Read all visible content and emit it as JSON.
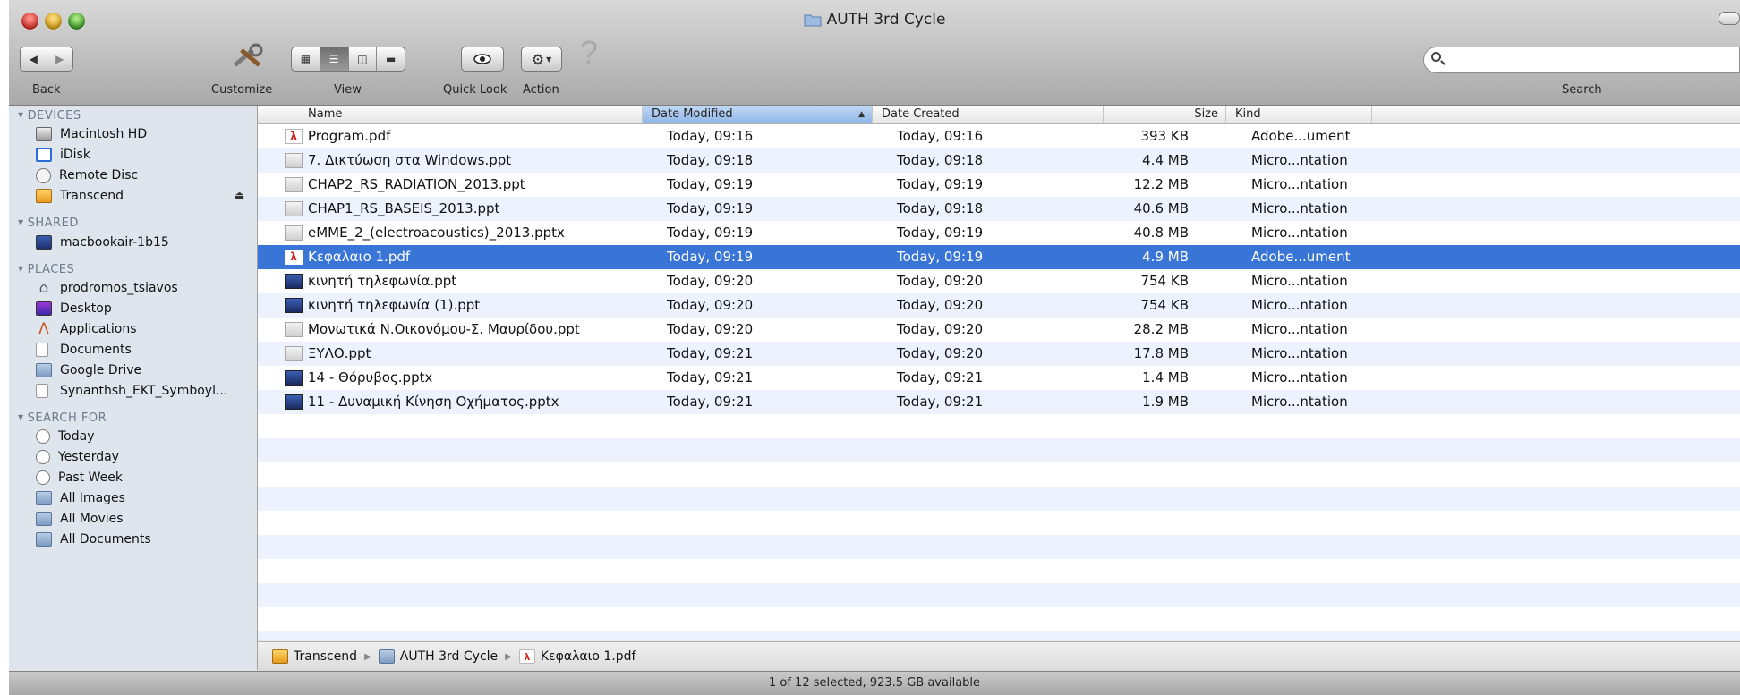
{
  "window": {
    "title": "AUTH 3rd Cycle"
  },
  "toolbar": {
    "back_label": "Back",
    "customize_label": "Customize",
    "view_label": "View",
    "quicklook_label": "Quick Look",
    "action_label": "Action",
    "search_label": "Search",
    "search_value": "",
    "view_modes": [
      "icon",
      "list",
      "column",
      "coverflow"
    ],
    "active_view_mode": "list"
  },
  "sidebar": {
    "sections": [
      {
        "heading": "DEVICES",
        "items": [
          {
            "label": "Macintosh HD",
            "icon": "hard-disk-icon"
          },
          {
            "label": "iDisk",
            "icon": "idisk-icon"
          },
          {
            "label": "Remote Disc",
            "icon": "remote-disc-icon"
          },
          {
            "label": "Transcend",
            "icon": "external-drive-icon",
            "ejectable": true
          }
        ]
      },
      {
        "heading": "SHARED",
        "items": [
          {
            "label": "macbookair-1b15",
            "icon": "computer-icon"
          }
        ]
      },
      {
        "heading": "PLACES",
        "items": [
          {
            "label": "prodromos_tsiavos",
            "icon": "home-icon"
          },
          {
            "label": "Desktop",
            "icon": "desktop-icon"
          },
          {
            "label": "Applications",
            "icon": "applications-icon"
          },
          {
            "label": "Documents",
            "icon": "documents-icon"
          },
          {
            "label": "Google Drive",
            "icon": "folder-icon"
          },
          {
            "label": "Synanthsh_EKT_Symboyl...",
            "icon": "document-icon"
          }
        ]
      },
      {
        "heading": "SEARCH FOR",
        "items": [
          {
            "label": "Today",
            "icon": "clock-icon"
          },
          {
            "label": "Yesterday",
            "icon": "clock-icon"
          },
          {
            "label": "Past Week",
            "icon": "clock-icon"
          },
          {
            "label": "All Images",
            "icon": "smart-folder-icon"
          },
          {
            "label": "All Movies",
            "icon": "smart-folder-icon"
          },
          {
            "label": "All Documents",
            "icon": "smart-folder-icon"
          }
        ]
      }
    ]
  },
  "columns": {
    "name": "Name",
    "date_modified": "Date Modified",
    "date_created": "Date Created",
    "size": "Size",
    "kind": "Kind",
    "sorted_by": "date_modified",
    "sort_direction": "ascending"
  },
  "files": [
    {
      "name": "Program.pdf",
      "modified": "Today, 09:16",
      "created": "Today, 09:16",
      "size": "393 KB",
      "kind": "Adobe...ument",
      "icon": "pdf-icon"
    },
    {
      "name": "7. Δικτύωση στα Windows.ppt",
      "modified": "Today, 09:18",
      "created": "Today, 09:18",
      "size": "4.4 MB",
      "kind": "Micro...ntation",
      "icon": "ppt-icon"
    },
    {
      "name": "CHAP2_RS_RADIATION_2013.ppt",
      "modified": "Today, 09:19",
      "created": "Today, 09:19",
      "size": "12.2 MB",
      "kind": "Micro...ntation",
      "icon": "ppt-icon"
    },
    {
      "name": "CHAP1_RS_BASEIS_2013.ppt",
      "modified": "Today, 09:19",
      "created": "Today, 09:18",
      "size": "40.6 MB",
      "kind": "Micro...ntation",
      "icon": "ppt-icon"
    },
    {
      "name": "eMME_2_(electroacoustics)_2013.pptx",
      "modified": "Today, 09:19",
      "created": "Today, 09:19",
      "size": "40.8 MB",
      "kind": "Micro...ntation",
      "icon": "ppt-icon"
    },
    {
      "name": "Κεφαλαιο 1.pdf",
      "modified": "Today, 09:19",
      "created": "Today, 09:19",
      "size": "4.9 MB",
      "kind": "Adobe...ument",
      "icon": "pdf-icon",
      "selected": true
    },
    {
      "name": "κινητή τηλεφωνία.ppt",
      "modified": "Today, 09:20",
      "created": "Today, 09:20",
      "size": "754 KB",
      "kind": "Micro...ntation",
      "icon": "ppt-dark-icon"
    },
    {
      "name": "κινητή τηλεφωνία (1).ppt",
      "modified": "Today, 09:20",
      "created": "Today, 09:20",
      "size": "754 KB",
      "kind": "Micro...ntation",
      "icon": "ppt-dark-icon"
    },
    {
      "name": "Μονωτικά Ν.Οικονόμου-Σ. Μαυρίδου.ppt",
      "modified": "Today, 09:20",
      "created": "Today, 09:20",
      "size": "28.2 MB",
      "kind": "Micro...ntation",
      "icon": "ppt-icon"
    },
    {
      "name": "ΞΥΛΟ.ppt",
      "modified": "Today, 09:21",
      "created": "Today, 09:20",
      "size": "17.8 MB",
      "kind": "Micro...ntation",
      "icon": "ppt-icon"
    },
    {
      "name": "14 - Θόρυβος.pptx",
      "modified": "Today, 09:21",
      "created": "Today, 09:21",
      "size": "1.4 MB",
      "kind": "Micro...ntation",
      "icon": "ppt-dark-icon"
    },
    {
      "name": "11 - Δυναμική Κίνηση Οχήματος.pptx",
      "modified": "Today, 09:21",
      "created": "Today, 09:21",
      "size": "1.9 MB",
      "kind": "Micro...ntation",
      "icon": "ppt-dark-icon"
    }
  ],
  "pathbar": [
    {
      "label": "Transcend",
      "icon": "external-drive-icon"
    },
    {
      "label": "AUTH 3rd Cycle",
      "icon": "folder-icon"
    },
    {
      "label": "Κεφαλαιο 1.pdf",
      "icon": "pdf-icon"
    }
  ],
  "status": {
    "text": "1 of 12 selected, 923.5 GB available"
  },
  "colors": {
    "selection": "#3875d7",
    "sidebar": "#dfe5ed",
    "stripe": "#edf3fe"
  }
}
